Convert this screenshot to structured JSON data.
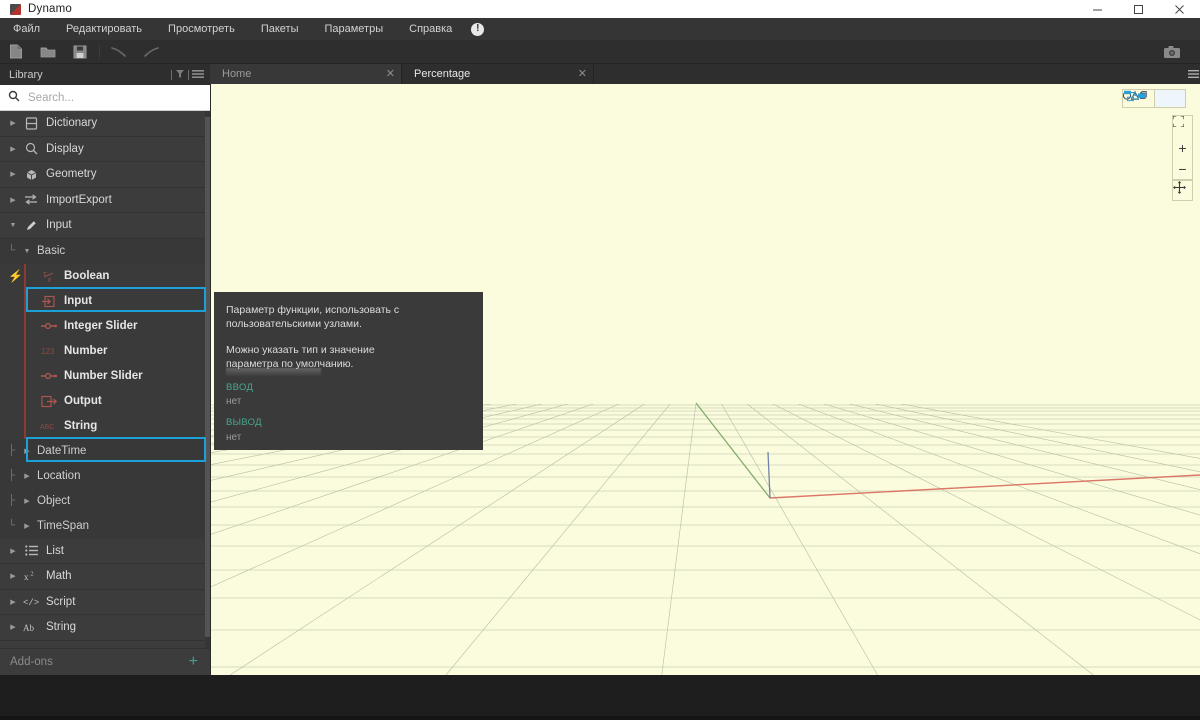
{
  "window": {
    "title": "Dynamo",
    "logo_icon": "dynamo-logo-icon",
    "minimize_label": "Minimize",
    "maximize_label": "Maximize",
    "close_label": "Close"
  },
  "menubar": {
    "items": [
      {
        "label": "Файл",
        "name": "menu-file"
      },
      {
        "label": "Редактировать",
        "name": "menu-edit"
      },
      {
        "label": "Просмотреть",
        "name": "menu-view"
      },
      {
        "label": "Пакеты",
        "name": "menu-packages"
      },
      {
        "label": "Параметры",
        "name": "menu-settings"
      },
      {
        "label": "Справка",
        "name": "menu-help"
      }
    ],
    "alert_badge": "!"
  },
  "toolbar": {
    "new_label": "New",
    "open_label": "Open",
    "save_label": "Save",
    "undo_label": "Undo",
    "redo_label": "Redo",
    "screenshot_label": "Screenshot"
  },
  "library": {
    "header_title": "Library",
    "filter_icon": "filter-icon",
    "menu_icon": "list-menu-icon",
    "search": {
      "placeholder": "Search...",
      "value": "",
      "icon": "search-icon"
    },
    "categories": [
      {
        "label": "Dictionary",
        "icon": "dictionary-icon",
        "expanded": false
      },
      {
        "label": "Display",
        "icon": "display-icon",
        "expanded": false
      },
      {
        "label": "Geometry",
        "icon": "geometry-icon",
        "expanded": false
      },
      {
        "label": "ImportExport",
        "icon": "importexport-icon",
        "expanded": false
      },
      {
        "label": "Input",
        "icon": "input-pencil-icon",
        "expanded": true
      }
    ],
    "input_group": {
      "label": "Basic",
      "nodes": [
        {
          "label": "Boolean",
          "icon": "boolean-tf-icon",
          "highlighted": false
        },
        {
          "label": "Input",
          "icon": "input-arrow-icon",
          "highlighted": true
        },
        {
          "label": "Integer Slider",
          "icon": "slider-icon",
          "highlighted": false
        },
        {
          "label": "Number",
          "icon": "number-123-icon",
          "highlighted": false
        },
        {
          "label": "Number Slider",
          "icon": "slider-icon",
          "highlighted": false
        },
        {
          "label": "Output",
          "icon": "output-arrow-icon",
          "highlighted": false
        },
        {
          "label": "String",
          "icon": "string-abc-icon",
          "highlighted": true
        }
      ],
      "subgroups": [
        {
          "label": "DateTime"
        },
        {
          "label": "Location"
        },
        {
          "label": "Object"
        },
        {
          "label": "TimeSpan"
        }
      ]
    },
    "bottom_categories": [
      {
        "label": "List",
        "icon": "list-icon"
      },
      {
        "label": "Math",
        "icon": "math-x2-icon"
      },
      {
        "label": "Script",
        "icon": "script-code-icon"
      },
      {
        "label": "String",
        "icon": "string-ab-icon"
      }
    ],
    "addons": {
      "label": "Add-ons",
      "plus_icon": "plus-icon"
    },
    "highlight_color": "#1ba1d8"
  },
  "tabs": [
    {
      "label": "Home",
      "active": false,
      "close_icon": "close-icon"
    },
    {
      "label": "Percentage",
      "active": true,
      "close_icon": "close-icon"
    }
  ],
  "tabstrip_menu_icon": "hamburger-icon",
  "tooltip": {
    "description_1": "Параметр функции, использовать с пользовательскими узлами.",
    "description_2": "Можно указать тип и значение параметра по умолчанию.",
    "input_section_label": "ВВОД",
    "input_value": "нет",
    "output_section_label": "ВЫВОД",
    "output_value": "нет",
    "icon": "input-node-arrow-icon",
    "accent_color": "#4aa58e",
    "background_color": "#3a3a3a"
  },
  "viewport": {
    "background_color": "#fbfbdd",
    "grid_color": "#9aa890",
    "axis_x_color": "#d96a5c",
    "axis_y_color": "#6fa05a",
    "axis_z_color": "#5a6fa0",
    "controls": {
      "geometry_view_label": "Geometry view",
      "graph_view_label": "Graph view",
      "zoom_fit_icon": "zoom-fit-icon",
      "zoom_in_label": "+",
      "zoom_out_label": "−",
      "pan_icon": "pan-move-icon"
    }
  }
}
